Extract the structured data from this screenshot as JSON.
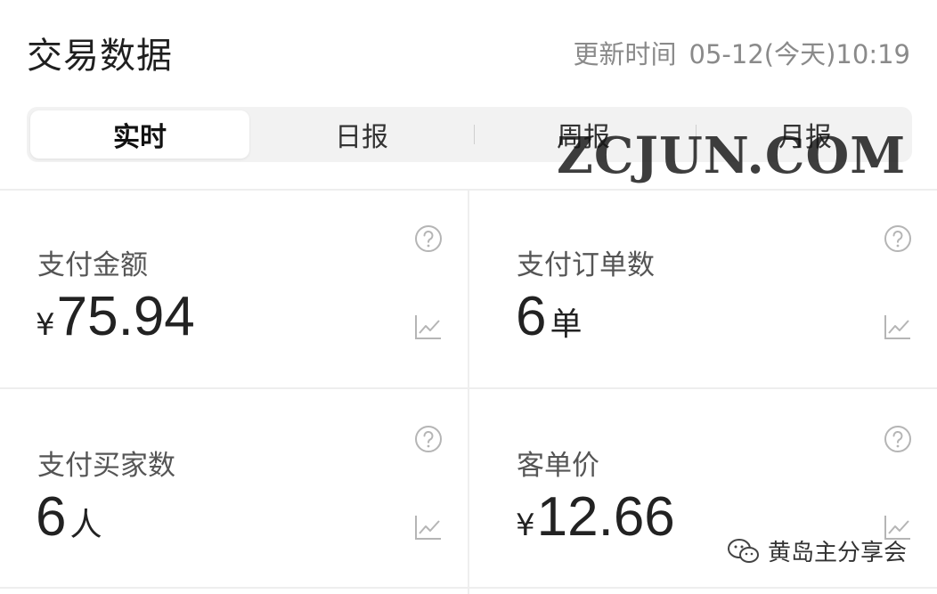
{
  "header": {
    "title": "交易数据",
    "update_label": "更新时间",
    "update_time": "05-12(今天)10:19"
  },
  "tabs": [
    {
      "label": "实时",
      "active": true
    },
    {
      "label": "日报",
      "active": false
    },
    {
      "label": "周报",
      "active": false
    },
    {
      "label": "月报",
      "active": false
    }
  ],
  "cards": [
    {
      "label": "支付金额",
      "prefix": "¥",
      "value": "75.94",
      "unit": ""
    },
    {
      "label": "支付订单数",
      "prefix": "",
      "value": "6",
      "unit": "单"
    },
    {
      "label": "支付买家数",
      "prefix": "",
      "value": "6",
      "unit": "人"
    },
    {
      "label": "客单价",
      "prefix": "¥",
      "value": "12.66",
      "unit": ""
    }
  ],
  "watermark": "ZCJUN.COM",
  "footer": {
    "text": "黄岛主分享会"
  },
  "colors": {
    "muted": "#8a8a8a",
    "divider": "#eeeeee",
    "tab_bg": "#f2f2f2",
    "icon": "#b5b5b5"
  }
}
